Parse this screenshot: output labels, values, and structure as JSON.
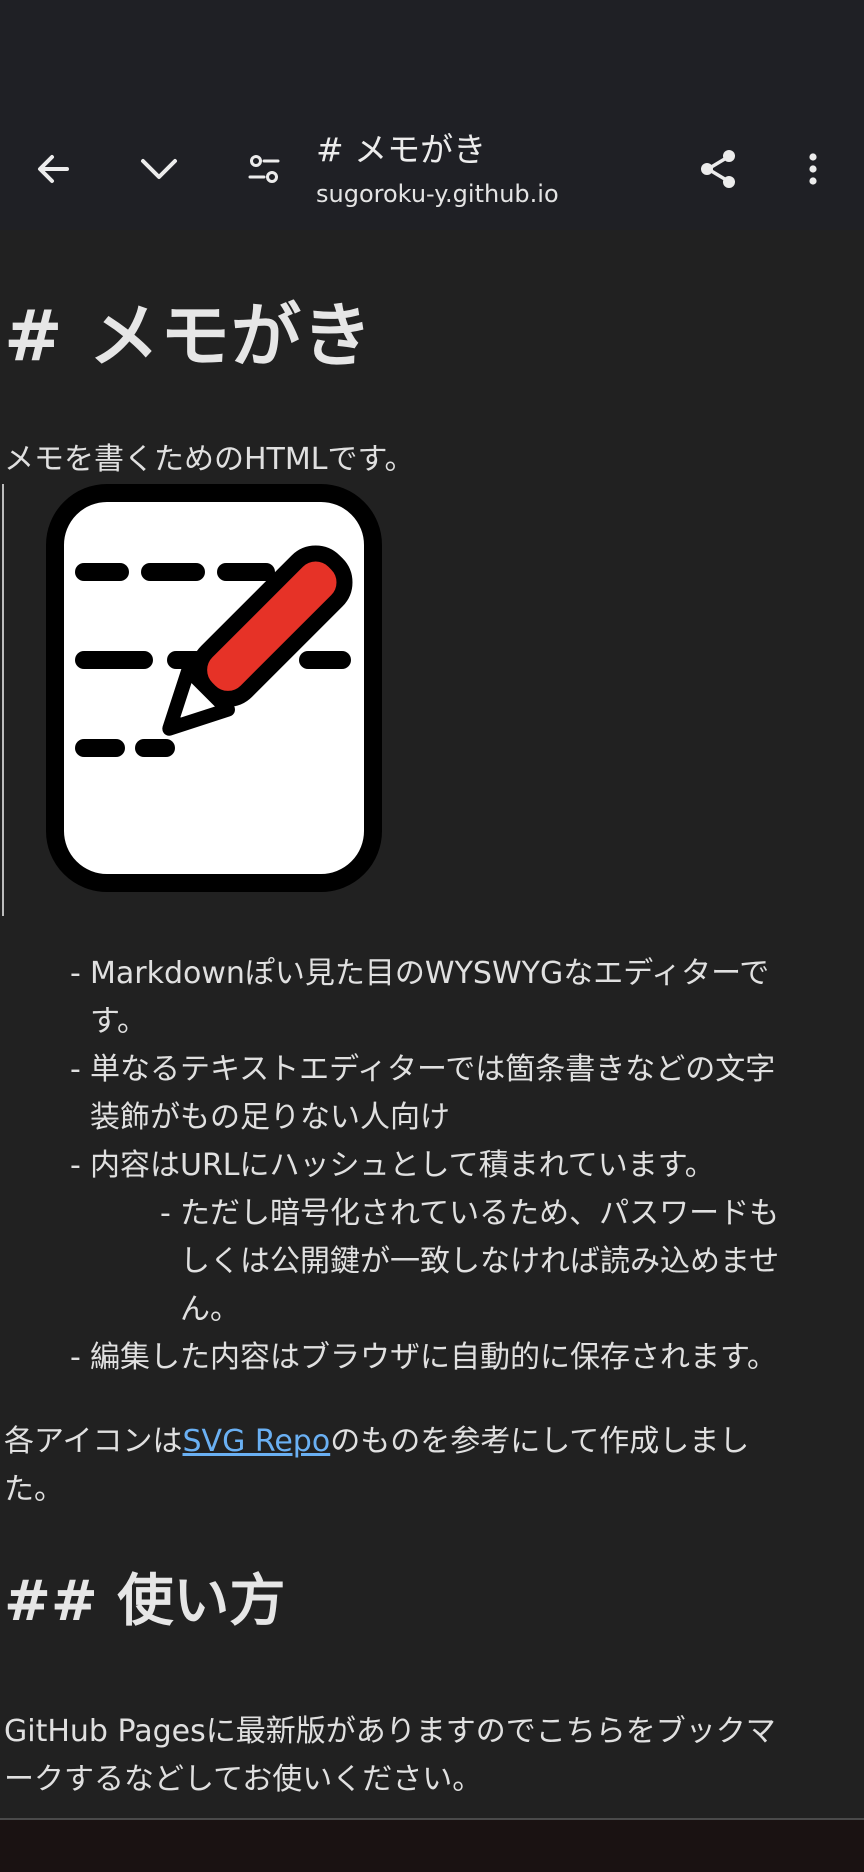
{
  "browser": {
    "title": "# メモがき",
    "url": "sugoroku-y.github.io"
  },
  "page": {
    "h1": "# メモがき",
    "intro": "メモを書くためのHTMLです。",
    "list": [
      {
        "lines": [
          "Markdownぽい見た目のWYSWYGなエディターで",
          "す。"
        ]
      },
      {
        "lines": [
          "単なるテキストエディターでは箇条書きなどの文字",
          "装飾がもの足りない人向け"
        ]
      },
      {
        "lines": [
          "内容はURLにハッシュとして積まれています。"
        ]
      },
      {
        "lines": [
          "ただし暗号化されているため、パスワードも",
          "しくは公開鍵が一致しなければ読み込めませ",
          "ん。"
        ],
        "nested": true
      },
      {
        "lines": [
          "編集した内容はブラウザに自動的に保存されます。"
        ]
      }
    ],
    "dash": "-",
    "credit_prefix": "各アイコンは",
    "credit_link": "SVG Repo",
    "credit_suffix_line1": "のものを参考にして作成しまし",
    "credit_suffix_line2": "た。",
    "h2": "## 使い方",
    "usage_line1": "GitHub Pagesに最新版がありますのでこちらをブックマ",
    "usage_line2": "ークするなどしてお使いください。"
  },
  "colors": {
    "background": "#212121",
    "toolbar": "#1f2025",
    "link": "#6ab0f3",
    "pencil": "#e63227"
  },
  "icons": [
    "back-arrow-icon",
    "chevron-down-icon",
    "tune-icon",
    "share-icon",
    "more-vert-icon",
    "memo-logo-icon"
  ]
}
